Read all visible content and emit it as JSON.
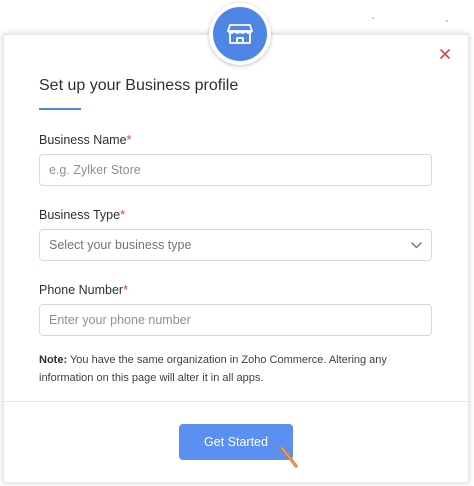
{
  "background": {
    "faint_text": "——————"
  },
  "modal": {
    "icon": "storefront-icon",
    "close_icon": "close-icon",
    "title": "Set up your Business profile",
    "fields": {
      "business_name": {
        "label": "Business Name",
        "required_mark": "*",
        "placeholder": "e.g. Zylker Store",
        "value": ""
      },
      "business_type": {
        "label": "Business Type",
        "required_mark": "*",
        "placeholder": "Select your business type",
        "icon": "chevron-down-icon"
      },
      "phone_number": {
        "label": "Phone Number",
        "required_mark": "*",
        "placeholder": "Enter your phone number",
        "value": ""
      }
    },
    "note": {
      "prefix": "Note:",
      "text": " You have the same organization in Zoho Commerce. Altering any information on this page will alter it in all apps."
    },
    "submit_label": "Get Started"
  },
  "colors": {
    "accent": "#4f86e6",
    "button": "#5b8ff0",
    "required": "#e04444",
    "close": "#e04444",
    "cursor": "#e8792b"
  }
}
